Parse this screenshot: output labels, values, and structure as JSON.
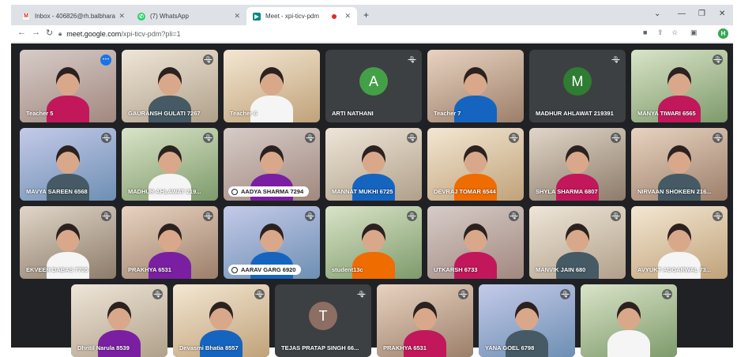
{
  "browser": {
    "tabs": [
      {
        "label": "Inbox - 406826@rh.balbharati.o",
        "favicon": "gmail-icon",
        "active": false
      },
      {
        "label": "(7) WhatsApp",
        "favicon": "whatsapp-icon",
        "active": false
      },
      {
        "label": "Meet - xpi-ticv-pdm",
        "favicon": "meet-icon",
        "active": true
      }
    ],
    "url_host": "meet.google.com",
    "url_path": "/xpi-ticv-pdm?pli=1",
    "profile_initial": "H"
  },
  "meet": {
    "tiles": [
      {
        "name": "Teacher 5",
        "kind": "video",
        "muted": false,
        "more": true,
        "selected": true
      },
      {
        "name": "GAURANSH GULATI 7267",
        "kind": "video",
        "muted": true
      },
      {
        "name": "Teacher 6",
        "kind": "video",
        "muted": false
      },
      {
        "name": "ARTI NATHANI",
        "kind": "avatar",
        "initial": "A",
        "color": "#43a047",
        "muted": true
      },
      {
        "name": "Teacher 7",
        "kind": "video",
        "muted": false
      },
      {
        "name": "MADHUR AHLAWAT 219391",
        "kind": "avatar",
        "initial": "M",
        "color": "#2e7d32",
        "muted": true
      },
      {
        "name": "MANYA TIWARI 6565",
        "kind": "video",
        "muted": true
      },
      {
        "name": "MAVYA SAREEN 6568",
        "kind": "video",
        "muted": true
      },
      {
        "name": "MADHUR AHLAWAT 219...",
        "kind": "video",
        "muted": true
      },
      {
        "name": "AADYA SHARMA 7294",
        "kind": "video",
        "muted": true,
        "pinned": true
      },
      {
        "name": "MANNAT MUKHI 6725",
        "kind": "video",
        "muted": true
      },
      {
        "name": "DEVRAJ TOMAR 6544",
        "kind": "video",
        "muted": true
      },
      {
        "name": "SHYLA SHARMA 6807",
        "kind": "video",
        "muted": true
      },
      {
        "name": "NIRVAAN SHOKEEN 216...",
        "kind": "video",
        "muted": true
      },
      {
        "name": "EKVEER DABAS 7705",
        "kind": "video",
        "muted": true
      },
      {
        "name": "PRAKHYA 6531",
        "kind": "video",
        "muted": true
      },
      {
        "name": "AARAV GARG 6920",
        "kind": "video",
        "muted": true,
        "pinned": true
      },
      {
        "name": "student13c",
        "kind": "video",
        "muted": true
      },
      {
        "name": "UTKARSH 6733",
        "kind": "video",
        "muted": true
      },
      {
        "name": "MANVIK JAIN 680",
        "kind": "video",
        "muted": true
      },
      {
        "name": "AVYUKT AGGARWAL 73...",
        "kind": "video",
        "muted": true
      },
      {
        "name": "Dhritil Narula 8539",
        "kind": "video",
        "muted": true
      },
      {
        "name": "Devasmi Bhatia 8557",
        "kind": "video",
        "muted": true
      },
      {
        "name": "TEJAS PRATAP SINGH 66...",
        "kind": "avatar",
        "initial": "T",
        "color": "#8d6e63",
        "muted": true
      },
      {
        "name": "PRAKHYA 6531",
        "kind": "video",
        "muted": true
      },
      {
        "name": "YANA GOEL 6798",
        "kind": "video",
        "muted": true
      },
      {
        "name": "",
        "kind": "video",
        "muted": true
      }
    ]
  }
}
